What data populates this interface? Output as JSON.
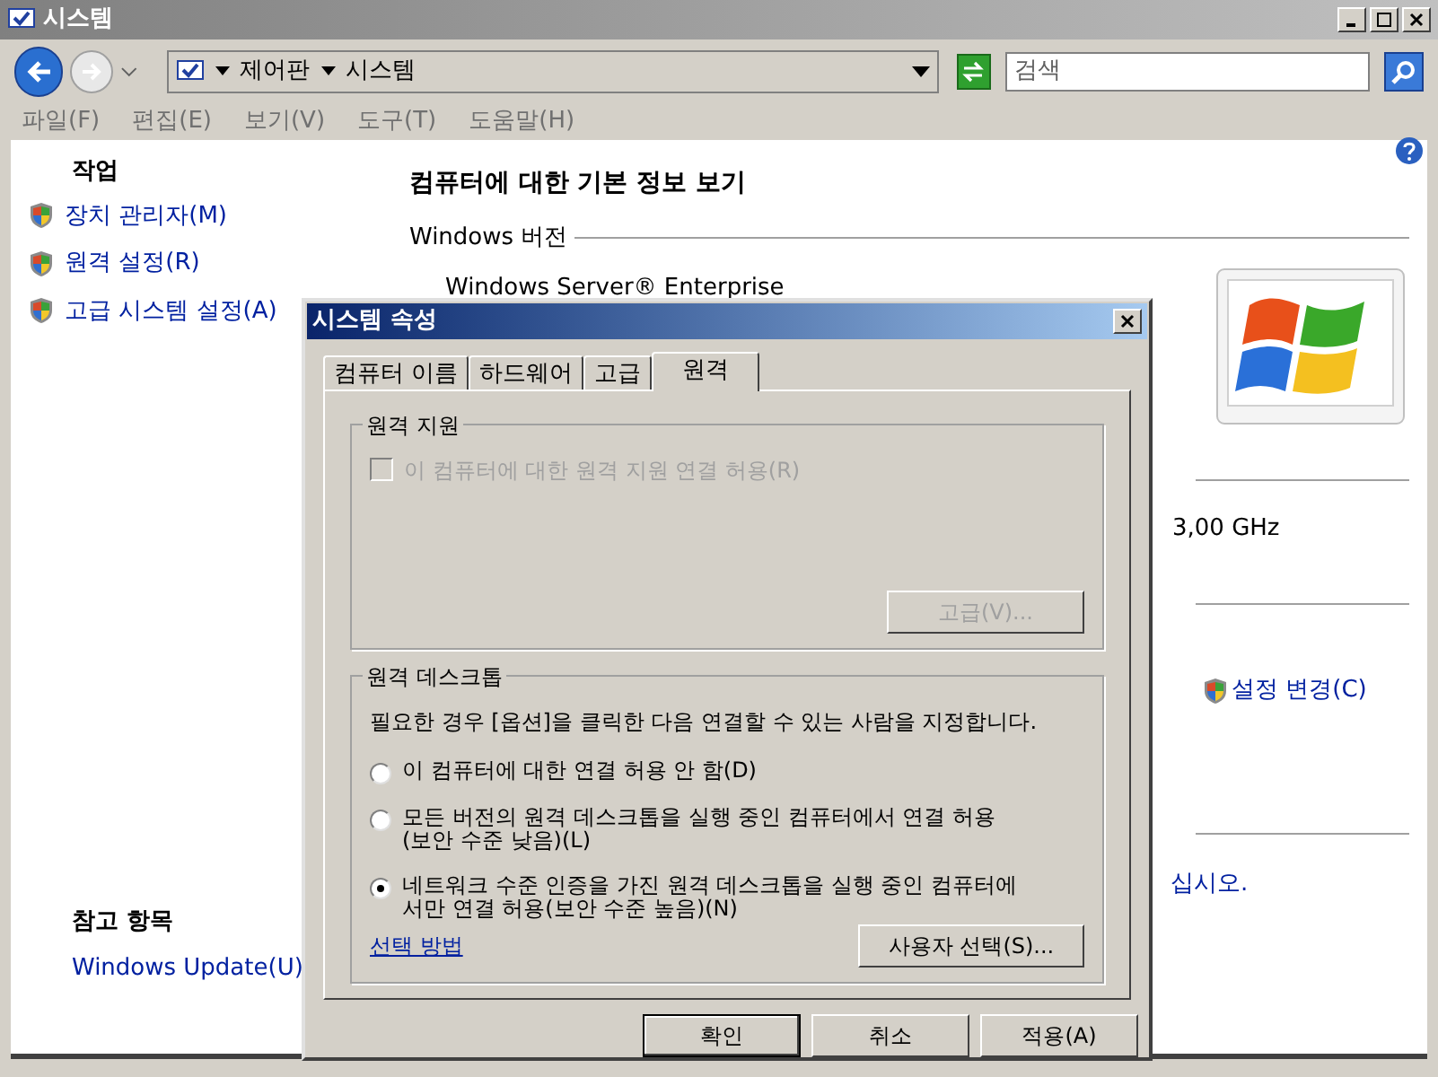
{
  "window": {
    "title": "시스템"
  },
  "address": {
    "crumbs": [
      "제어판",
      "시스템"
    ]
  },
  "search": {
    "placeholder": "검색"
  },
  "menu": [
    "파일(F)",
    "편집(E)",
    "보기(V)",
    "도구(T)",
    "도움말(H)"
  ],
  "sidebar": {
    "heading": "작업",
    "tasks": [
      "장치 관리자(M)",
      "원격 설정(R)",
      "고급 시스템 설정(A)"
    ],
    "see_also_heading": "참고 항목",
    "links": [
      "Windows Update(U)"
    ]
  },
  "main": {
    "heading": "컴퓨터에 대한 기본 정보 보기",
    "section": "Windows 버전",
    "edition": "Windows Server® Enterprise",
    "processor_speed": "3,00 GHz",
    "change_settings": "설정 변경(C)",
    "partial_text": "십시오."
  },
  "dialog": {
    "title": "시스템 속성",
    "tabs": [
      {
        "label": "컴퓨터 이름",
        "selected": false
      },
      {
        "label": "하드웨어",
        "selected": false
      },
      {
        "label": "고급",
        "selected": false
      },
      {
        "label": "원격",
        "selected": true
      }
    ],
    "remote_assistance": {
      "title": "원격 지원",
      "checkbox": {
        "label": "이 컴퓨터에 대한 원격 지원 연결 허용(R)",
        "checked": false,
        "disabled": true
      },
      "button": {
        "label": "고급(V)...",
        "disabled": true
      }
    },
    "remote_desktop": {
      "title": "원격 데스크톱",
      "description": "필요한 경우 [옵션]을 클릭한 다음 연결할 수 있는 사람을 지정합니다.",
      "options": [
        {
          "label": "이 컴퓨터에 대한 연결 허용 안 함(D)",
          "selected": false
        },
        {
          "label": "모든 버전의 원격 데스크톱을 실행 중인 컴퓨터에서 연결 허용 (보안 수준 낮음)(L)",
          "selected": false
        },
        {
          "label": "네트워크 수준 인증을 가진 원격 데스크톱을 실행 중인 컴퓨터에서만 연결 허용(보안 수준 높음)(N)",
          "selected": true
        }
      ],
      "help_link": "선택 방법",
      "select_users_button": "사용자 선택(S)..."
    },
    "buttons": [
      {
        "label": "확인",
        "default": true
      },
      {
        "label": "취소",
        "default": false
      },
      {
        "label": "적용(A)",
        "default": false
      }
    ]
  }
}
